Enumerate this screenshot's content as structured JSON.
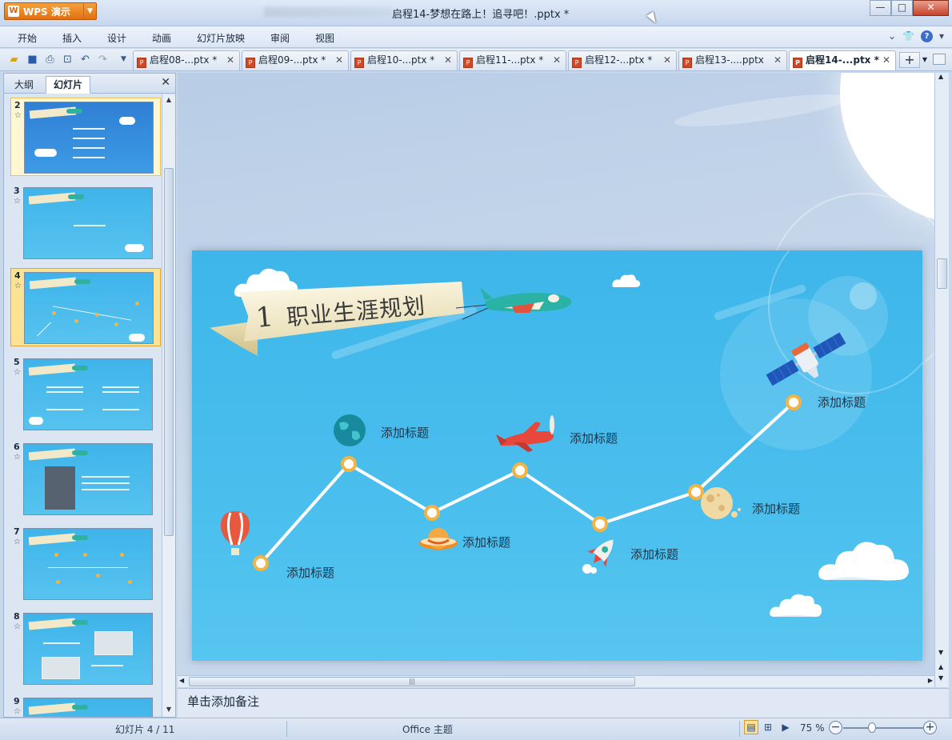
{
  "app": {
    "name": "WPS 演示",
    "window_title": "启程14-梦想在路上！追寻吧！.pptx *"
  },
  "window_controls": {
    "minimize": "—",
    "maximize": "□",
    "close": "✕"
  },
  "menu": [
    "开始",
    "插入",
    "设计",
    "动画",
    "幻灯片放映",
    "审阅",
    "视图"
  ],
  "toolbar_icons": [
    "open-folder-icon",
    "save-icon",
    "print-icon",
    "print-preview-icon",
    "undo-icon",
    "redo-icon",
    "customize-dropdown-icon"
  ],
  "tabs": [
    {
      "label": "启程08-...ptx *"
    },
    {
      "label": "启程09-...ptx *"
    },
    {
      "label": "启程10-...ptx *"
    },
    {
      "label": "启程11-...ptx *"
    },
    {
      "label": "启程12-...ptx *"
    },
    {
      "label": "启程13-....pptx"
    },
    {
      "label": "启程14-...ptx *"
    }
  ],
  "active_tab_index": 6,
  "panel": {
    "tab_outline": "大纲",
    "tab_slides": "幻灯片",
    "close": "✕"
  },
  "slides": [
    {
      "num": "2"
    },
    {
      "num": "3"
    },
    {
      "num": "4"
    },
    {
      "num": "5"
    },
    {
      "num": "6"
    },
    {
      "num": "7"
    },
    {
      "num": "8"
    },
    {
      "num": "9"
    }
  ],
  "current_slide": "4",
  "slide": {
    "number": "1",
    "title": "职业生涯规划",
    "waypoints": [
      "添加标题",
      "添加标题",
      "添加标题",
      "添加标题",
      "添加标题",
      "添加标题",
      "添加标题"
    ]
  },
  "notes_placeholder": "单击添加备注",
  "status": {
    "slide_counter": "幻灯片 4 / 11",
    "theme": "Office 主题",
    "zoom": "75 %"
  },
  "colors": {
    "accent": "#e87a14",
    "slide_bg": "#45bbec",
    "route_dot": "#f2b444"
  }
}
